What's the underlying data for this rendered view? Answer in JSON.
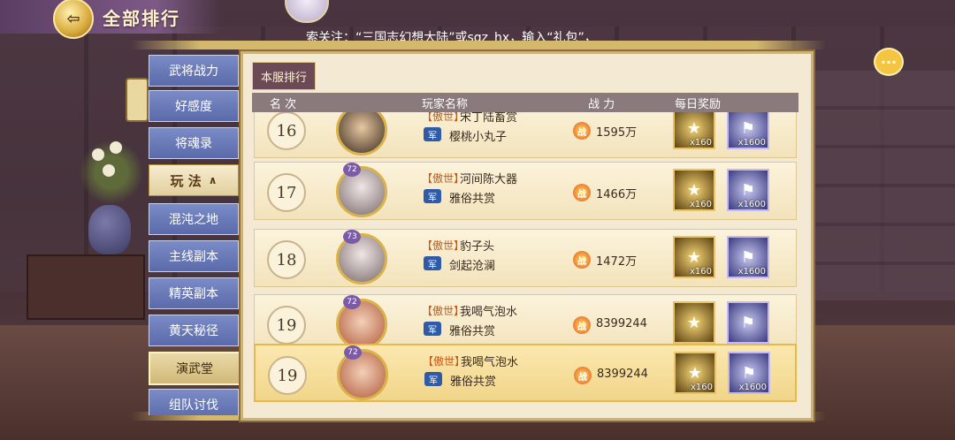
{
  "header": {
    "title": "全部排行",
    "notice": "索关注：“三国志幻想大陆”或sgz_hx，输入“礼包”，"
  },
  "side_menu": [
    {
      "label": "武将战力",
      "type": "item"
    },
    {
      "label": "好感度",
      "type": "item"
    },
    {
      "label": "将魂录",
      "type": "item"
    },
    {
      "label": "玩 法",
      "type": "section",
      "icon": "chevron-up-icon"
    },
    {
      "label": "混沌之地",
      "type": "item"
    },
    {
      "label": "主线副本",
      "type": "item"
    },
    {
      "label": "精英副本",
      "type": "item"
    },
    {
      "label": "黄天秘径",
      "type": "item"
    },
    {
      "label": "演武堂",
      "type": "item",
      "active": true
    },
    {
      "label": "组队讨伐",
      "type": "item"
    }
  ],
  "tab": {
    "label": "本服排行"
  },
  "columns": {
    "rank": "名 次",
    "player": "玩家名称",
    "power": "战 力",
    "reward": "每日奖励"
  },
  "power_icon_text": "战",
  "guild_icon_text": "军",
  "rows": [
    {
      "rank": "16",
      "level": "",
      "tag": "【傲世】",
      "name": "宋丁陆畜赏",
      "guild": "樱桃小丸子",
      "power": "1595万",
      "reward_gold_qty": "x160",
      "reward_blue_qty": "x1600",
      "avatar": "dark"
    },
    {
      "rank": "17",
      "level": "72",
      "tag": "【傲世】",
      "name": "河间陈大器",
      "guild": "雅俗共赏",
      "power": "1466万",
      "reward_gold_qty": "x160",
      "reward_blue_qty": "x1600",
      "avatar": "light"
    },
    {
      "rank": "18",
      "level": "73",
      "tag": "【傲世】",
      "name": "豹子头",
      "guild": "剑起沧澜",
      "power": "1472万",
      "reward_gold_qty": "x160",
      "reward_blue_qty": "x1600",
      "avatar": "light"
    },
    {
      "rank": "19",
      "level": "72",
      "tag": "【傲世】",
      "name": "我喝气泡水",
      "guild": "雅俗共赏",
      "power": "8399244",
      "reward_gold_qty": "",
      "reward_blue_qty": "",
      "avatar": "red"
    },
    {
      "rank": "19",
      "level": "72",
      "tag": "【傲世】",
      "name": "我喝气泡水",
      "guild": "雅俗共赏",
      "power": "8399244",
      "reward_gold_qty": "x160",
      "reward_blue_qty": "x1600",
      "avatar": "red",
      "selected": true
    }
  ],
  "colors": {
    "accent_gold": "#d9b24a",
    "panel_bg": "#f4ead3",
    "menu_blue": "#6b7ab8",
    "tab_bg": "#6b4a56"
  }
}
